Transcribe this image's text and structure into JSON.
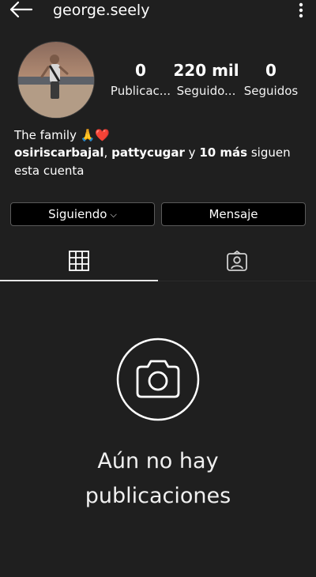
{
  "header": {
    "username": "george.seely"
  },
  "profile": {
    "stats": [
      {
        "value": "0",
        "label": "Publicac..."
      },
      {
        "value": "220 mil",
        "label": "Seguido..."
      },
      {
        "value": "0",
        "label": "Seguidos"
      }
    ],
    "bio": "The family 🙏❤️",
    "followed_by": {
      "user1": "osiriscarbajal",
      "separator": ", ",
      "user2": "pattycugar",
      "conj": " y ",
      "more": "10 más",
      "suffix": " siguen esta cuenta"
    }
  },
  "actions": {
    "following_label": "Siguiendo",
    "message_label": "Mensaje"
  },
  "tabs": [
    {
      "icon": "grid-icon",
      "active": true
    },
    {
      "icon": "tagged-person-icon",
      "active": false
    }
  ],
  "empty_state": {
    "icon": "camera-icon",
    "line1": "Aún no hay",
    "line2": "publicaciones"
  },
  "colors": {
    "background": "#1f1f1f",
    "button_bg": "#000000",
    "text": "#ffffff"
  }
}
